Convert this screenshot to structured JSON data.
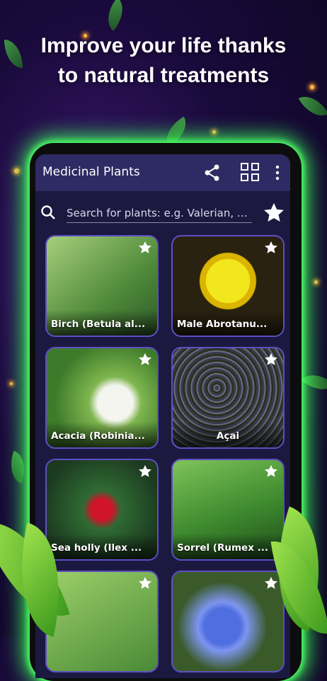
{
  "headline": {
    "line1": "Improve your life thanks",
    "line2": "to natural treatments"
  },
  "app": {
    "title": "Medicinal Plants"
  },
  "toolbar": {
    "share_icon": "share-icon",
    "grid_icon": "grid-view-icon",
    "menu_icon": "more-vert-icon"
  },
  "search": {
    "placeholder": "Search for plants: e.g. Valerian, ..."
  },
  "plants": [
    {
      "label": "Birch (Betula al..."
    },
    {
      "label": "Male Abrotanu..."
    },
    {
      "label": "Acacia (Robinia..."
    },
    {
      "label": "Açai"
    },
    {
      "label": "Sea holly (Ilex ..."
    },
    {
      "label": "Sorrel (Rumex ..."
    },
    {
      "label": ""
    },
    {
      "label": ""
    }
  ],
  "colors": {
    "accent_glow": "#3cff5a",
    "appbar": "#2e2a63",
    "card_border": "#5d4fc4",
    "background": "#1b1940"
  }
}
